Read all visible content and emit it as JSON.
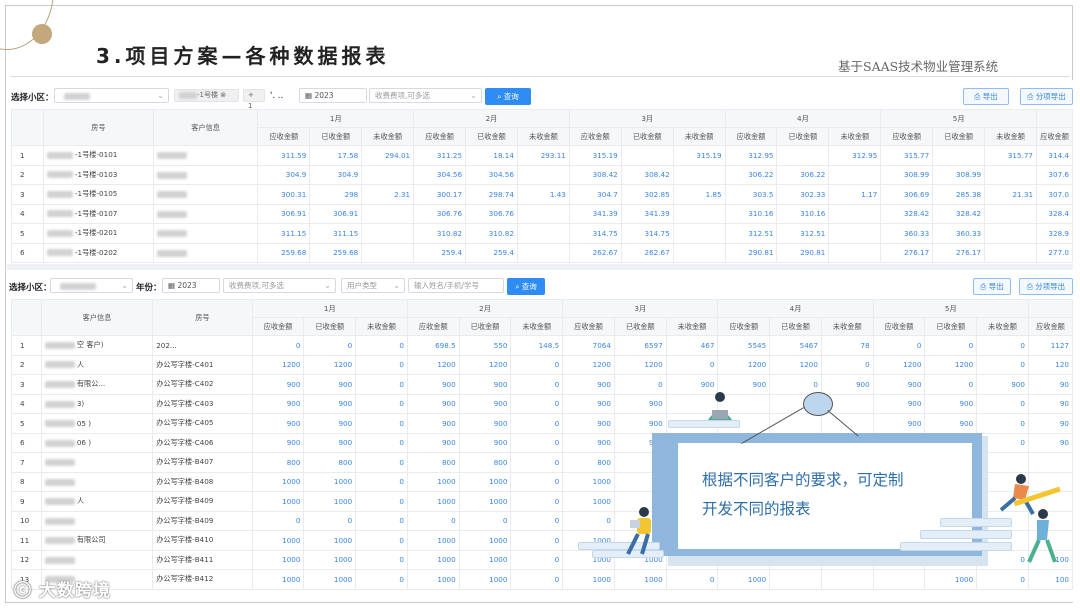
{
  "slide": {
    "title": "3.项目方案—各种数据报表",
    "subtitle": "基于SAAS技术物业管理系统",
    "callout_line1": "根据不同客户的要求，可定制",
    "callout_line2": "开发不同的报表",
    "watermark": "大数跨境"
  },
  "panel1": {
    "filter": {
      "label": "选择小区：",
      "community_tag": "-1号楼",
      "more_tag": "+ 1",
      "dots": "'. ..",
      "year": "2023",
      "fee_placeholder": "收费费项,可多选",
      "search": "查询",
      "export": "导出",
      "export_items": "分项导出"
    },
    "headers": {
      "room": "房号",
      "customer": "客户信息",
      "months": [
        "1月",
        "2月",
        "3月",
        "4月",
        "5月"
      ],
      "sub": [
        "应收金额",
        "已收金额",
        "未收金额"
      ]
    },
    "rows": [
      {
        "idx": "1",
        "room": "-1号楼-0101",
        "v": [
          "311.59",
          "17.58",
          "294.01",
          "311.25",
          "18.14",
          "293.11",
          "315.19",
          "",
          "315.19",
          "312.95",
          "",
          "312.95",
          "315.77",
          "",
          "315.77",
          "314.4"
        ]
      },
      {
        "idx": "2",
        "room": "-1号楼-0103",
        "v": [
          "304.9",
          "304.9",
          "",
          "304.56",
          "304.56",
          "",
          "308.42",
          "308.42",
          "",
          "306.22",
          "306.22",
          "",
          "308.99",
          "308.99",
          "",
          "307.6"
        ]
      },
      {
        "idx": "3",
        "room": "-1号楼-0105",
        "v": [
          "300.31",
          "298",
          "2.31",
          "300.17",
          "298.74",
          "1.43",
          "304.7",
          "302.85",
          "1.85",
          "303.5",
          "302.33",
          "1.17",
          "306.69",
          "285.38",
          "21.31",
          "307.0"
        ]
      },
      {
        "idx": "4",
        "room": "-1号楼-0107",
        "v": [
          "306.91",
          "306.91",
          "",
          "306.76",
          "306.76",
          "",
          "341.39",
          "341.39",
          "",
          "310.16",
          "310.16",
          "",
          "328.42",
          "328.42",
          "",
          "328.4"
        ]
      },
      {
        "idx": "5",
        "room": "-1号楼-0201",
        "v": [
          "311.15",
          "311.15",
          "",
          "310.82",
          "310.82",
          "",
          "314.75",
          "314.75",
          "",
          "312.51",
          "312.51",
          "",
          "360.33",
          "360.33",
          "",
          "328.9"
        ]
      },
      {
        "idx": "6",
        "room": "-1号楼-0202",
        "v": [
          "259.68",
          "259.68",
          "",
          "259.4",
          "259.4",
          "",
          "262.67",
          "262.67",
          "",
          "290.81",
          "290.81",
          "",
          "276.17",
          "276.17",
          "",
          "277.0"
        ]
      }
    ]
  },
  "panel2": {
    "filter": {
      "label": "选择小区：",
      "year_label": "年份：",
      "year": "2023",
      "fee_placeholder": "收费费项,可多选",
      "user_type_placeholder": "用户类型",
      "name_placeholder": "输入姓名/手机/学号",
      "search": "查询",
      "export": "导出",
      "export_items": "分项导出"
    },
    "headers": {
      "customer": "客户信息",
      "room": "房号",
      "months": [
        "1月",
        "2月",
        "3月",
        "4月",
        "5月"
      ],
      "sub": [
        "应收金额",
        "已收金额",
        "未收金额"
      ]
    },
    "rows": [
      {
        "idx": "1",
        "customer": "空 客户)",
        "room": "202...",
        "v": [
          "0",
          "0",
          "0",
          "698.5",
          "550",
          "148.5",
          "7064",
          "6597",
          "467",
          "5545",
          "5467",
          "78",
          "0",
          "0",
          "0",
          "1127"
        ]
      },
      {
        "idx": "2",
        "customer": "人",
        "room": "办公写字楼-C401",
        "v": [
          "1200",
          "1200",
          "0",
          "1200",
          "1200",
          "0",
          "1200",
          "1200",
          "0",
          "1200",
          "1200",
          "0",
          "1200",
          "1200",
          "0",
          "120"
        ]
      },
      {
        "idx": "3",
        "customer": "有限公...",
        "room": "办公写字楼-C402",
        "v": [
          "900",
          "900",
          "0",
          "900",
          "900",
          "0",
          "900",
          "0",
          "900",
          "900",
          "0",
          "900",
          "900",
          "0",
          "900",
          "90"
        ]
      },
      {
        "idx": "4",
        "customer": "3)",
        "room": "办公写字楼-C403",
        "v": [
          "900",
          "900",
          "0",
          "900",
          "900",
          "0",
          "900",
          "900",
          "",
          "",
          "",
          "",
          "900",
          "900",
          "0",
          "90"
        ]
      },
      {
        "idx": "5",
        "customer": "05 )",
        "room": "办公写字楼-C405",
        "v": [
          "900",
          "900",
          "0",
          "900",
          "900",
          "0",
          "900",
          "900",
          "",
          "",
          "",
          "",
          "900",
          "900",
          "0",
          "90"
        ]
      },
      {
        "idx": "6",
        "customer": "06 )",
        "room": "办公写字楼-C406",
        "v": [
          "900",
          "900",
          "0",
          "900",
          "900",
          "0",
          "900",
          "900",
          "",
          "",
          "",
          "",
          "900",
          "900",
          "0",
          "90"
        ]
      },
      {
        "idx": "7",
        "customer": "",
        "room": "办公写字楼-B407",
        "v": [
          "800",
          "800",
          "0",
          "800",
          "800",
          "0",
          "800",
          "",
          "",
          "",
          "",
          "",
          "",
          "",
          "",
          ""
        ]
      },
      {
        "idx": "8",
        "customer": "",
        "room": "办公写字楼-B408",
        "v": [
          "1000",
          "1000",
          "0",
          "1000",
          "1000",
          "0",
          "1000",
          "",
          "",
          "",
          "",
          "",
          "",
          "",
          "",
          ""
        ]
      },
      {
        "idx": "9",
        "customer": "人",
        "room": "办公写字楼-B409",
        "v": [
          "1000",
          "1000",
          "0",
          "1000",
          "1000",
          "0",
          "1000",
          "",
          "",
          "",
          "",
          "",
          "",
          "",
          "",
          ""
        ]
      },
      {
        "idx": "10",
        "customer": "",
        "room": "办公写字楼-B409",
        "v": [
          "0",
          "0",
          "0",
          "0",
          "0",
          "0",
          "0",
          "",
          "",
          "",
          "",
          "",
          "",
          "",
          "",
          ""
        ]
      },
      {
        "idx": "11",
        "customer": "有限公司",
        "room": "办公写字楼-B410",
        "v": [
          "1000",
          "1000",
          "0",
          "1000",
          "1000",
          "0",
          "1000",
          "",
          "",
          "",
          "",
          "",
          "",
          "",
          "",
          ""
        ]
      },
      {
        "idx": "12",
        "customer": "",
        "room": "办公写字楼-B411",
        "v": [
          "1000",
          "1000",
          "0",
          "1000",
          "1000",
          "0",
          "1000",
          "1000",
          "0",
          "1000",
          "",
          "",
          "",
          "1000",
          "0",
          "100"
        ]
      },
      {
        "idx": "13",
        "customer": "",
        "room": "办公写字楼-B412",
        "v": [
          "1000",
          "1000",
          "0",
          "1000",
          "1000",
          "0",
          "1000",
          "1000",
          "0",
          "1000",
          "",
          "",
          "",
          "1000",
          "0",
          "100"
        ]
      }
    ]
  },
  "colors": {
    "accent": "#2f8cf3",
    "value": "#3a86e6",
    "callout": "#8fb6dc",
    "callout_text": "#2e6ea9"
  }
}
